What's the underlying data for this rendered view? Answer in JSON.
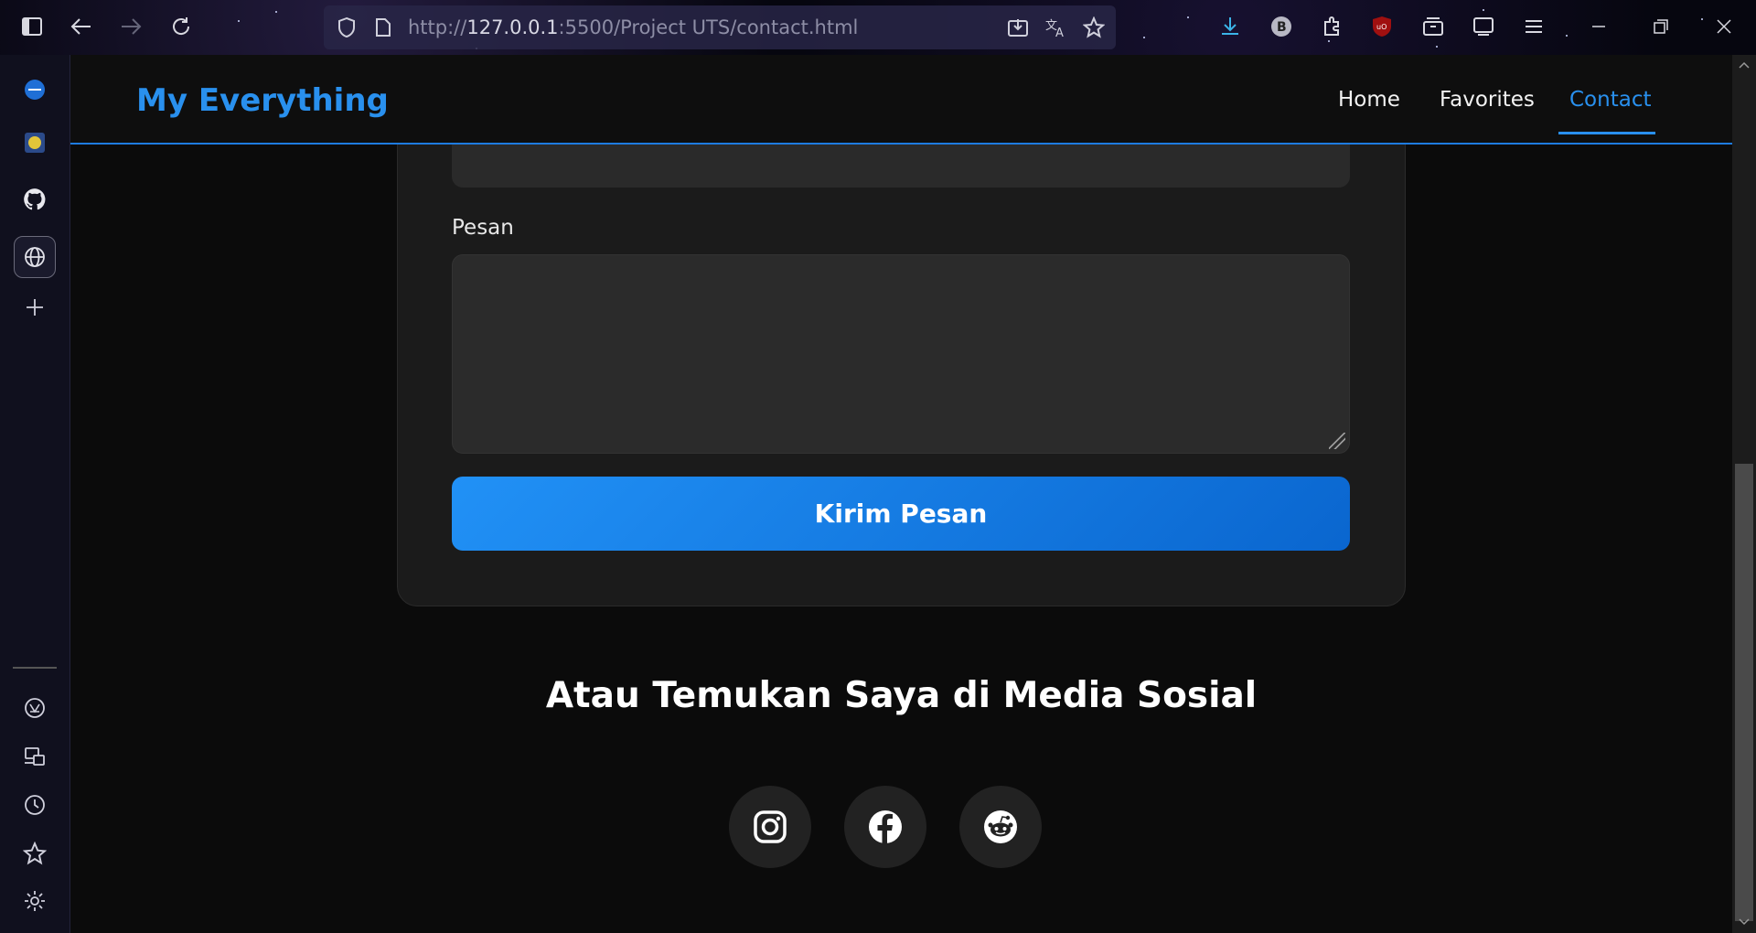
{
  "browser": {
    "url_prefix": "http://",
    "url_host": "127.0.0.1",
    "url_rest": ":5500/Project UTS/contact.html"
  },
  "navbar": {
    "brand": "My Everything",
    "links": [
      {
        "label": "Home"
      },
      {
        "label": "Favorites"
      },
      {
        "label": "Contact"
      }
    ],
    "active": "Contact"
  },
  "form": {
    "message_label": "Pesan",
    "message_value": "",
    "submit_label": "Kirim Pesan"
  },
  "social": {
    "heading": "Atau Temukan Saya di Media Sosial",
    "links": [
      {
        "icon": "instagram-icon"
      },
      {
        "icon": "facebook-icon"
      },
      {
        "icon": "reddit-icon"
      }
    ]
  },
  "colors": {
    "accent": "#2990ee",
    "background": "#0b0b0b",
    "card": "#1b1b1b",
    "button_start": "#2191f6",
    "button_end": "#0a66cf"
  }
}
